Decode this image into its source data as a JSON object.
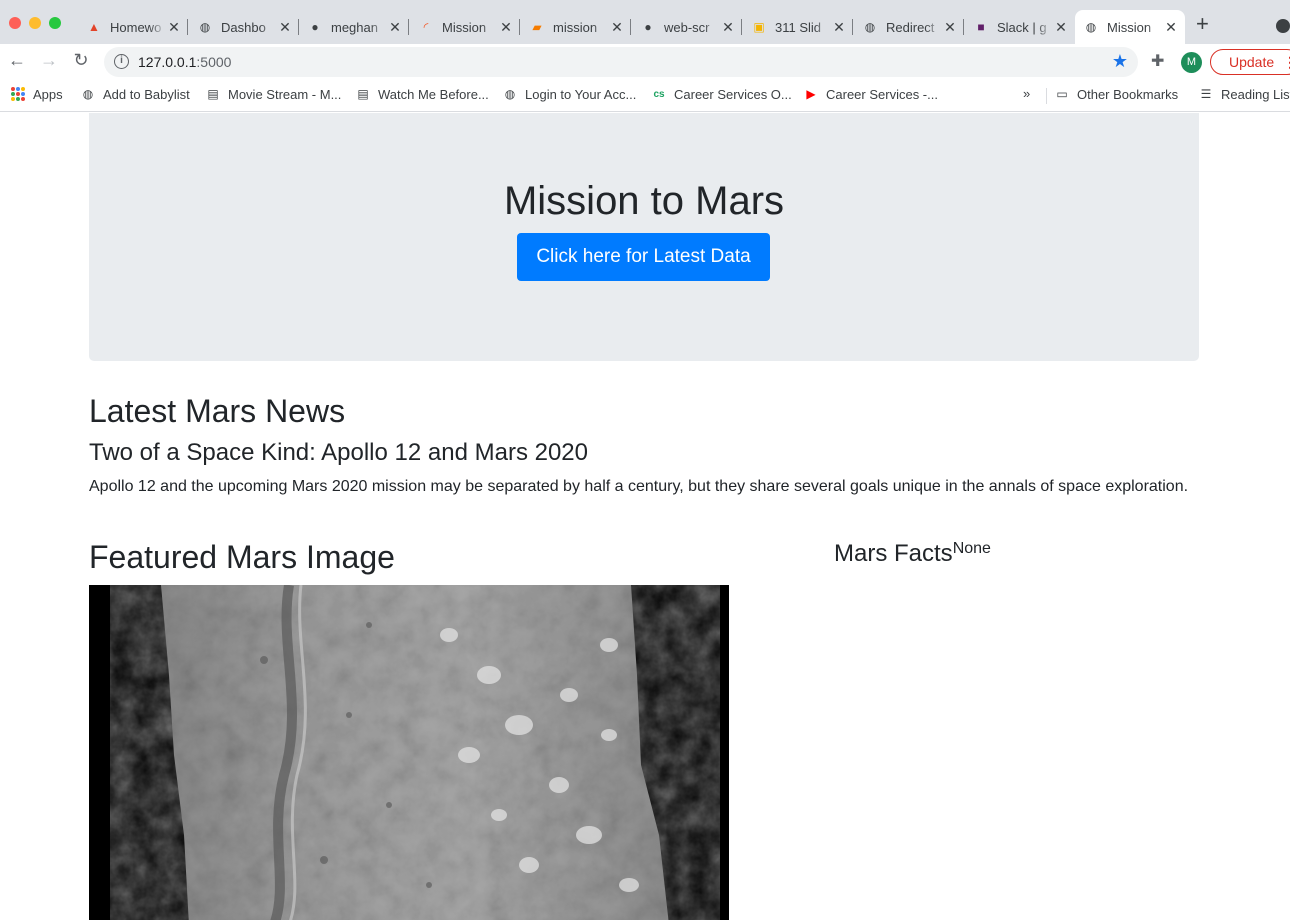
{
  "browser": {
    "tabs": [
      {
        "title": "Homewo",
        "icon": "gitlab-icon"
      },
      {
        "title": "Dashbo",
        "icon": "globe-icon"
      },
      {
        "title": "meghan",
        "icon": "github-icon"
      },
      {
        "title": "Mission",
        "icon": "loading-icon"
      },
      {
        "title": "mission",
        "icon": "book-icon"
      },
      {
        "title": "web-scr",
        "icon": "github-icon"
      },
      {
        "title": "311 Slid",
        "icon": "slides-icon"
      },
      {
        "title": "Redirect",
        "icon": "globe-icon"
      },
      {
        "title": "Slack | g",
        "icon": "slack-icon"
      },
      {
        "title": "Mission",
        "icon": "globe-icon",
        "active": true
      }
    ],
    "url_host": "127.0.0.1",
    "url_port": ":5000",
    "profile_initial": "M",
    "update_label": "Update",
    "bookmarks": [
      {
        "label": "Apps",
        "icon": "apps-grid-icon"
      },
      {
        "label": "Add to Babylist",
        "icon": "globe-icon"
      },
      {
        "label": "Movie Stream - M...",
        "icon": "movie-icon"
      },
      {
        "label": "Watch Me Before...",
        "icon": "movie-icon"
      },
      {
        "label": "Login to Your Acc...",
        "icon": "globe-icon"
      },
      {
        "label": "Career Services O...",
        "icon": "cs-icon"
      },
      {
        "label": "Career Services -...",
        "icon": "youtube-icon"
      }
    ],
    "other_bookmarks": "Other Bookmarks",
    "reading_list": "Reading List",
    "colors": {
      "accent": "#1a73e8",
      "update": "#d93025",
      "avatar": "#1e8e5a"
    }
  },
  "page": {
    "title": "Mission to Mars",
    "scrape_button": "Click here for Latest Data",
    "news_heading": "Latest Mars News",
    "news_title": "Two of a Space Kind: Apollo 12 and Mars 2020",
    "news_paragraph": "Apollo 12 and the upcoming Mars 2020 mission may be separated by half a century, but they share several goals unique in the annals of space exploration.",
    "featured_heading": "Featured Mars Image",
    "facts_heading": "Mars Facts",
    "facts_value": "None",
    "colors": {
      "button": "#007bff",
      "jumbotron": "#e9ecef",
      "text": "#212529"
    }
  }
}
